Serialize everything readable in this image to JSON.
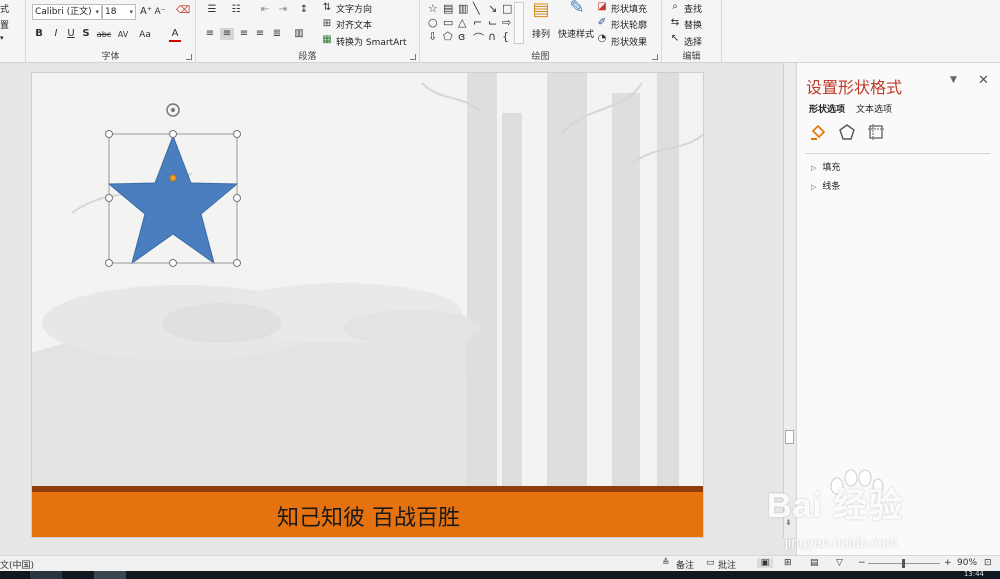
{
  "ribbon": {
    "left_cut": {
      "line1": "式",
      "line2": "置",
      "arrow": "▾"
    },
    "font": {
      "name_value": "Calibri (正文)",
      "size_value": "18",
      "grow": "A⁺",
      "shrink": "A⁻",
      "clear": "⌫",
      "bold": "B",
      "italic": "I",
      "underline": "U",
      "shadow": "S",
      "strike": "abc",
      "spacing": "AV",
      "case": "Aa",
      "color": "A",
      "label": "字体"
    },
    "paragraph": {
      "text_direction": "文字方向",
      "align_text": "对齐文本",
      "convert_smartart": "转换为 SmartArt",
      "label": "段落"
    },
    "drawing": {
      "arrange": "排列",
      "quick_styles": "快速样式",
      "shape_fill": "形状填充",
      "shape_outline": "形状轮廓",
      "shape_effects": "形状效果",
      "label": "绘图"
    },
    "editing": {
      "find": "查找",
      "replace": "替换",
      "select": "选择",
      "label": "编辑"
    }
  },
  "slide": {
    "footer_text": "知己知彼 百战百胜",
    "star_color": "#4a7ebf",
    "footer_color": "#e5720e"
  },
  "pane": {
    "title": "设置形状格式",
    "tabs": [
      "形状选项",
      "文本选项"
    ],
    "sections": [
      "填充",
      "线条"
    ]
  },
  "status": {
    "language": "文(中国)",
    "notes": "备注",
    "comments": "批注",
    "zoom": "90%",
    "time": "13:44"
  },
  "watermark": {
    "brand": "Bai 经验",
    "url": "jingyan.baidu.com"
  }
}
